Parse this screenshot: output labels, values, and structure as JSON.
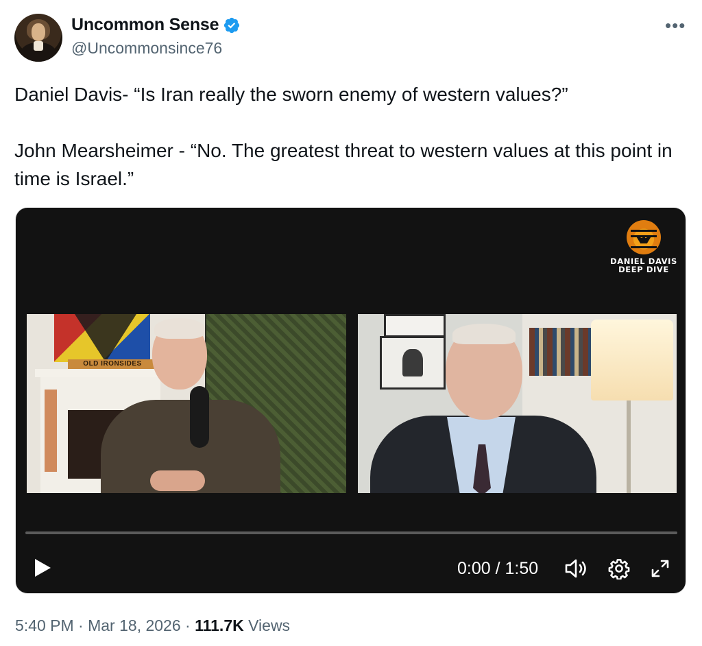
{
  "author": {
    "display_name": "Uncommon Sense",
    "handle": "@Uncommonsince76",
    "verified": true,
    "avatar_icon": "portrait-avatar"
  },
  "more_icon": "more-horizontal-icon",
  "tweet": {
    "line1": "Daniel Davis- “Is Iran really the sworn enemy of western values?”",
    "line2": "John Mearsheimer - “No. The greatest threat to western values at this point in time is Israel.”"
  },
  "video": {
    "logo_line1": "DANIEL DAVIS",
    "logo_line2": "DEEP DIVE",
    "sign_text": "OLD IRONSIDES",
    "time_display": "0:00 / 1:50",
    "progress_fraction": 0,
    "controls": {
      "play_icon": "play-icon",
      "volume_icon": "volume-icon",
      "settings_icon": "gear-icon",
      "fullscreen_icon": "expand-icon"
    }
  },
  "meta": {
    "time": "5:40 PM",
    "separator": "·",
    "date": "Mar 18, 2026",
    "views_count": "111.7K",
    "views_label": "Views"
  },
  "colors": {
    "verified_blue": "#1d9bf0",
    "secondary_text": "#536471",
    "primary_text": "#0f1419",
    "video_bg": "#121212"
  }
}
